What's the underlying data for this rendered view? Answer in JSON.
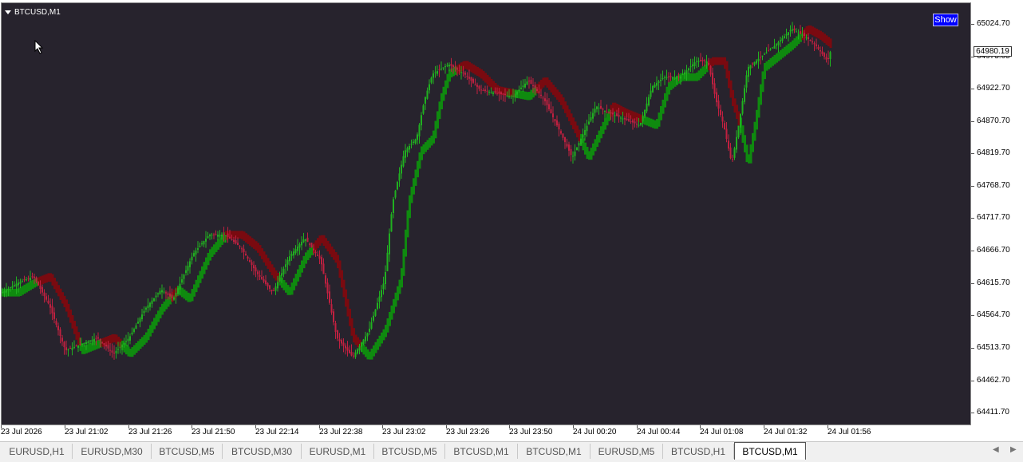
{
  "window": {
    "symbol_title": "BTCUSD,M1",
    "show_button_label": "Show",
    "current_price": "64980.19"
  },
  "colors": {
    "background": "#27232d",
    "bull_candle": "#20b020",
    "bear_candle": "#c02040",
    "bull_band": "#0f8a0f",
    "bear_band": "#7a0a10",
    "show_button": "#0000ff"
  },
  "icons": {
    "collapse": "triangle-down-icon",
    "cursor": "mouse-pointer-icon",
    "scroll_left": "chevron-left-icon",
    "scroll_right": "chevron-right-icon"
  },
  "chart_data": {
    "type": "candlestick",
    "price_axis_labels": [
      "65024.70",
      "64973.05",
      "64922.70",
      "64870.70",
      "64819.70",
      "64768.70",
      "64717.70",
      "64666.70",
      "64615.70",
      "64564.70",
      "64513.70",
      "64462.70",
      "64411.70"
    ],
    "time_axis_labels": [
      "23 Jul 2026",
      "23 Jul 21:02",
      "23 Jul 21:26",
      "23 Jul 21:50",
      "23 Jul 22:14",
      "23 Jul 22:38",
      "23 Jul 23:02",
      "23 Jul 23:26",
      "23 Jul 23:50",
      "24 Jul 00:20",
      "24 Jul 00:44",
      "24 Jul 01:08",
      "24 Jul 01:32",
      "24 Jul 01:56"
    ],
    "ylim": [
      64395,
      65050
    ],
    "close_path": [
      [
        0,
        64600
      ],
      [
        20,
        64615
      ],
      [
        40,
        64625
      ],
      [
        60,
        64580
      ],
      [
        80,
        64510
      ],
      [
        100,
        64520
      ],
      [
        120,
        64530
      ],
      [
        140,
        64505
      ],
      [
        160,
        64530
      ],
      [
        180,
        64575
      ],
      [
        200,
        64605
      ],
      [
        215,
        64590
      ],
      [
        240,
        64660
      ],
      [
        260,
        64690
      ],
      [
        280,
        64690
      ],
      [
        300,
        64670
      ],
      [
        320,
        64630
      ],
      [
        340,
        64600
      ],
      [
        360,
        64655
      ],
      [
        380,
        64685
      ],
      [
        400,
        64650
      ],
      [
        420,
        64530
      ],
      [
        440,
        64500
      ],
      [
        460,
        64540
      ],
      [
        480,
        64620
      ],
      [
        490,
        64740
      ],
      [
        505,
        64820
      ],
      [
        520,
        64840
      ],
      [
        530,
        64900
      ],
      [
        540,
        64940
      ],
      [
        560,
        64955
      ],
      [
        580,
        64940
      ],
      [
        600,
        64915
      ],
      [
        620,
        64910
      ],
      [
        640,
        64905
      ],
      [
        660,
        64930
      ],
      [
        680,
        64900
      ],
      [
        700,
        64850
      ],
      [
        715,
        64810
      ],
      [
        730,
        64850
      ],
      [
        745,
        64890
      ],
      [
        760,
        64880
      ],
      [
        780,
        64870
      ],
      [
        800,
        64860
      ],
      [
        815,
        64920
      ],
      [
        830,
        64935
      ],
      [
        850,
        64935
      ],
      [
        870,
        64960
      ],
      [
        885,
        64960
      ],
      [
        895,
        64900
      ],
      [
        905,
        64860
      ],
      [
        915,
        64800
      ],
      [
        925,
        64870
      ],
      [
        935,
        64950
      ],
      [
        950,
        64965
      ],
      [
        970,
        64985
      ],
      [
        990,
        65010
      ],
      [
        1005,
        65000
      ],
      [
        1020,
        64985
      ],
      [
        1035,
        64960
      ],
      [
        1040,
        64980
      ]
    ],
    "indicator": "trend-colored smoothed band (green = up, dark red = down)",
    "grid": false
  },
  "tabs": [
    {
      "label": "EURUSD,H1",
      "active": false
    },
    {
      "label": "EURUSD,M30",
      "active": false
    },
    {
      "label": "BTCUSD,M5",
      "active": false
    },
    {
      "label": "BTCUSD,M30",
      "active": false
    },
    {
      "label": "EURUSD,M1",
      "active": false
    },
    {
      "label": "BTCUSD,M5",
      "active": false
    },
    {
      "label": "BTCUSD,M1",
      "active": false
    },
    {
      "label": "BTCUSD,M1",
      "active": false
    },
    {
      "label": "EURUSD,M5",
      "active": false
    },
    {
      "label": "BTCUSD,H1",
      "active": false
    },
    {
      "label": "BTCUSD,M1",
      "active": true
    }
  ]
}
